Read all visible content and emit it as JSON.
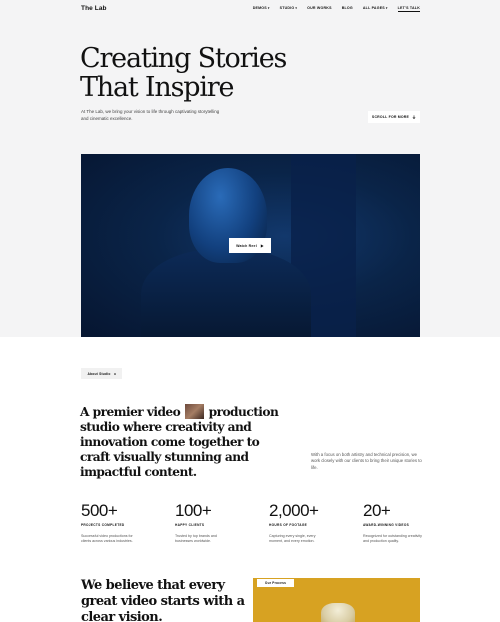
{
  "nav": {
    "logo": "The Lab",
    "items": [
      {
        "label": "Demos",
        "caret": "▾"
      },
      {
        "label": "Studio",
        "caret": "▾"
      },
      {
        "label": "Our Works",
        "caret": ""
      },
      {
        "label": "Blog",
        "caret": ""
      },
      {
        "label": "All Pages",
        "caret": "▾"
      }
    ],
    "cta": "Let's Talk"
  },
  "hero": {
    "title_line1": "Creating Stories",
    "title_line2": "That Inspire",
    "subtitle": "At The Lab, we bring your vision to life through captivating storytelling and cinematic excellence.",
    "scroll_button": "Scroll for more",
    "watch_button": "Watch Reel"
  },
  "about": {
    "tag": "About Studio",
    "statement_part1": "A premier video",
    "statement_part2": "production studio where creativity and innovation come together to craft visually stunning and impactful content.",
    "side_note": "With a focus on both artistry and technical precision, we work closely with our clients to bring their unique stories to life."
  },
  "stats": [
    {
      "value": "500+",
      "label": "Projects Completed",
      "desc": "Successful video productions for clients across various industries."
    },
    {
      "value": "100+",
      "label": "Happy Clients",
      "desc": "Trusted by top brands and businesses worldwide."
    },
    {
      "value": "2,000+",
      "label": "Hours of Footage",
      "desc": "Capturing every single, every moment, and every emotion."
    },
    {
      "value": "20+",
      "label": "Award-Winning Videos",
      "desc": "Recognized for outstanding creativity and production quality."
    }
  ],
  "process": {
    "headline": "We believe that every great video starts with a clear vision.",
    "tag": "Our Process"
  },
  "icons": {
    "caret": "chevron-down-icon",
    "arrow": "arrow-down-icon",
    "play": "play-icon"
  },
  "colors": {
    "background": "#f4f4f5",
    "hero_image": "#0a2448",
    "process_image": "#d7a222"
  }
}
